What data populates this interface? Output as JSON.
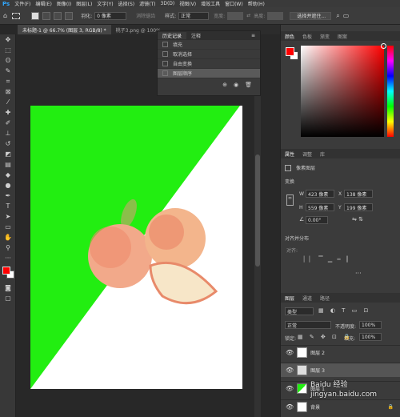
{
  "menubar": {
    "items": [
      "文件(F)",
      "编辑(E)",
      "图像(I)",
      "图层(L)",
      "文字(Y)",
      "选择(S)",
      "滤镜(T)",
      "3D(D)",
      "视图(V)",
      "增效工具",
      "窗口(W)",
      "帮助(H)"
    ]
  },
  "options": {
    "feather_label": "羽化:",
    "feather_value": "0 像素",
    "antialias": "消除锯齿",
    "style_label": "样式:",
    "style_value": "正常",
    "width_label": "宽度:",
    "height_label": "高度:",
    "select_button": "选择并遮住..."
  },
  "tabs": [
    {
      "label": "未标题-1 @ 66.7% (图层 3, RGB/8) *"
    },
    {
      "label": "桃子3.png @ 100%"
    }
  ],
  "history": {
    "tabs": [
      "历史记录",
      "注释"
    ],
    "items": [
      "填充",
      "取消选择",
      "自由变换",
      "图层顺序"
    ],
    "selected": 3
  },
  "colors": {
    "fg": "#ff0000",
    "bg": "#ffffff",
    "canvas_green": "#22ee11"
  },
  "color_panel": {
    "tabs": [
      "颜色",
      "色板",
      "渐变",
      "图案"
    ]
  },
  "properties": {
    "tabs": [
      "属性",
      "调整",
      "库"
    ],
    "type_label": "像素图层",
    "section": "变换",
    "w_label": "W",
    "w_value": "423 像素",
    "x_label": "X",
    "x_value": "138 像素",
    "h_label": "H",
    "h_value": "559 像素",
    "y_label": "Y",
    "y_value": "199 像素",
    "angle_value": "0.00°",
    "align_section": "对齐并分布",
    "align_label": "对齐:"
  },
  "layers_panel": {
    "tabs": [
      "图层",
      "通道",
      "路径"
    ],
    "kind": "类型",
    "blend": "正常",
    "opacity_label": "不透明度:",
    "opacity": "100%",
    "lock_label": "锁定:",
    "fill_label": "填充:",
    "fill": "100%",
    "layers": [
      {
        "name": "图层 2"
      },
      {
        "name": "图层 3"
      },
      {
        "name": "图层 1"
      },
      {
        "name": "背景"
      }
    ]
  },
  "watermark": "Baidu 经验\njingyan.baidu.com"
}
